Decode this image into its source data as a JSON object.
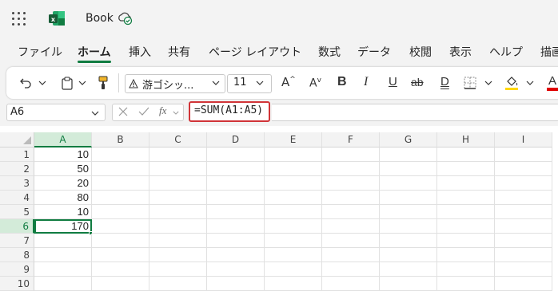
{
  "app": {
    "document_title": "Book",
    "app_icon": "excel-icon",
    "accent_color": "#107c41",
    "highlight_color": "#d13438"
  },
  "tabs": [
    {
      "label": "ファイル",
      "active": false
    },
    {
      "label": "ホーム",
      "active": true
    },
    {
      "label": "挿入",
      "active": false
    },
    {
      "label": "共有",
      "active": false
    },
    {
      "label": "ページ レイアウト",
      "active": false
    },
    {
      "label": "数式",
      "active": false
    },
    {
      "label": "データ",
      "active": false
    },
    {
      "label": "校閲",
      "active": false
    },
    {
      "label": "表示",
      "active": false
    },
    {
      "label": "ヘルプ",
      "active": false
    },
    {
      "label": "描画",
      "active": false
    }
  ],
  "toolbar": {
    "font_name": "游ゴシッ...",
    "font_size": "11",
    "buttons": [
      "undo-icon",
      "paste-icon",
      "format-painter-icon",
      "increase-font-icon",
      "decrease-font-icon",
      "bold-icon",
      "italic-icon",
      "underline-icon",
      "strikethrough-icon",
      "double-underline-icon",
      "borders-icon",
      "fill-color-icon",
      "font-color-icon"
    ],
    "labels": {
      "bold": "B",
      "italic": "I",
      "underline": "U",
      "strikethrough": "ab",
      "double_underline": "D",
      "font_color": "A"
    }
  },
  "formula_bar": {
    "name_box": "A6",
    "fx_label": "fx",
    "formula": "=SUM(A1:A5)"
  },
  "sheet": {
    "columns": [
      "A",
      "B",
      "C",
      "D",
      "E",
      "F",
      "G",
      "H",
      "I"
    ],
    "rows": [
      "1",
      "2",
      "3",
      "4",
      "5",
      "6",
      "7",
      "8",
      "9",
      "10"
    ],
    "selected_column": "A",
    "selected_row": "6",
    "values_col_a": [
      "10",
      "50",
      "20",
      "80",
      "10",
      "170",
      "",
      "",
      "",
      ""
    ]
  }
}
